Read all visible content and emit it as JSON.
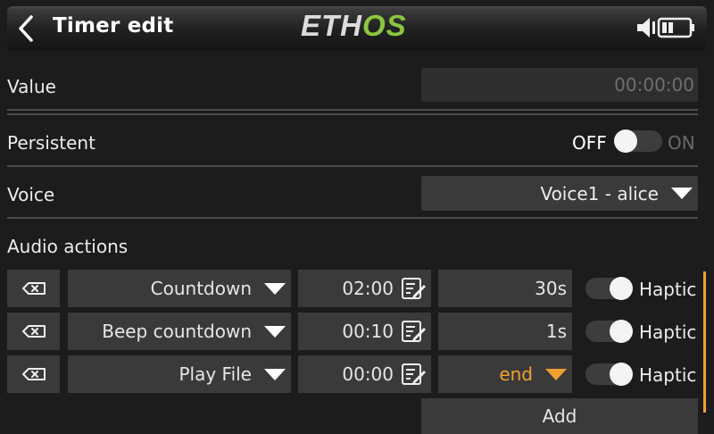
{
  "header": {
    "title": "Timer edit",
    "logo_left": "ETH",
    "logo_right": "OS",
    "back_icon": "chevron-left-icon",
    "speaker_icon": "speaker-icon",
    "battery_icon": "battery-icon"
  },
  "value": {
    "label": "Value",
    "field": "00:00:00"
  },
  "persistent": {
    "label": "Persistent",
    "off_label": "OFF",
    "on_label": "ON",
    "state": "off"
  },
  "voice": {
    "label": "Voice",
    "value": "Voice1 - alice"
  },
  "audio_actions": {
    "label": "Audio actions",
    "rows": [
      {
        "type": "Countdown",
        "time": "02:00",
        "param": "30s",
        "param_dropdown": false,
        "haptic_label": "Haptic",
        "haptic": "on"
      },
      {
        "type": "Beep countdown",
        "time": "00:10",
        "param": "1s",
        "param_dropdown": false,
        "haptic_label": "Haptic",
        "haptic": "on"
      },
      {
        "type": "Play File",
        "time": "00:00",
        "param": "end",
        "param_dropdown": true,
        "haptic_label": "Haptic",
        "haptic": "on"
      }
    ],
    "add_label": "Add"
  },
  "colors": {
    "accent": "#f0a030",
    "logo_green": "#8cc63f",
    "background": "#1c1c1c",
    "field": "#3a3a3a"
  }
}
